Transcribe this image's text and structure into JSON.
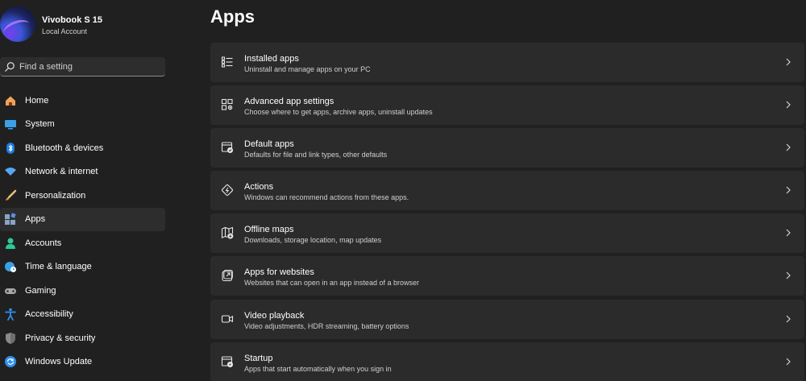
{
  "profile": {
    "name": "Vivobook S 15",
    "account_type": "Local Account"
  },
  "search": {
    "placeholder": "Find a setting"
  },
  "nav": {
    "active": "Apps",
    "items": [
      {
        "label": "Home",
        "icon": "home-icon",
        "color": "#f0a35c"
      },
      {
        "label": "System",
        "icon": "monitor-icon",
        "color": "#3aa0e8"
      },
      {
        "label": "Bluetooth & devices",
        "icon": "bluetooth-icon",
        "color": "#1e7de0"
      },
      {
        "label": "Network & internet",
        "icon": "wifi-icon",
        "color": "#55a8f0"
      },
      {
        "label": "Personalization",
        "icon": "brush-icon",
        "color": "#e8953a"
      },
      {
        "label": "Apps",
        "icon": "apps-icon",
        "color": "#8aa4c8"
      },
      {
        "label": "Accounts",
        "icon": "person-icon",
        "color": "#2ec79a"
      },
      {
        "label": "Time & language",
        "icon": "globe-clock-icon",
        "color": "#3aa0e8"
      },
      {
        "label": "Gaming",
        "icon": "gamepad-icon",
        "color": "#a8a8a8"
      },
      {
        "label": "Accessibility",
        "icon": "accessibility-icon",
        "color": "#2f8ff0"
      },
      {
        "label": "Privacy & security",
        "icon": "shield-icon",
        "color": "#8a8a8a"
      },
      {
        "label": "Windows Update",
        "icon": "update-icon",
        "color": "#2f8ff0"
      }
    ]
  },
  "main": {
    "title": "Apps",
    "cards": [
      {
        "title": "Installed apps",
        "description": "Uninstall and manage apps on your PC",
        "icon": "list-icon"
      },
      {
        "title": "Advanced app settings",
        "description": "Choose where to get apps, archive apps, uninstall updates",
        "icon": "apps-settings-icon"
      },
      {
        "title": "Default apps",
        "description": "Defaults for file and link types, other defaults",
        "icon": "default-app-icon"
      },
      {
        "title": "Actions",
        "description": "Windows can recommend actions from these apps.",
        "icon": "actions-icon"
      },
      {
        "title": "Offline maps",
        "description": "Downloads, storage location, map updates",
        "icon": "map-icon"
      },
      {
        "title": "Apps for websites",
        "description": "Websites that can open in an app instead of a browser",
        "icon": "open-link-icon"
      },
      {
        "title": "Video playback",
        "description": "Video adjustments, HDR streaming, battery options",
        "icon": "video-icon"
      },
      {
        "title": "Startup",
        "description": "Apps that start automatically when you sign in",
        "icon": "startup-icon"
      }
    ]
  }
}
